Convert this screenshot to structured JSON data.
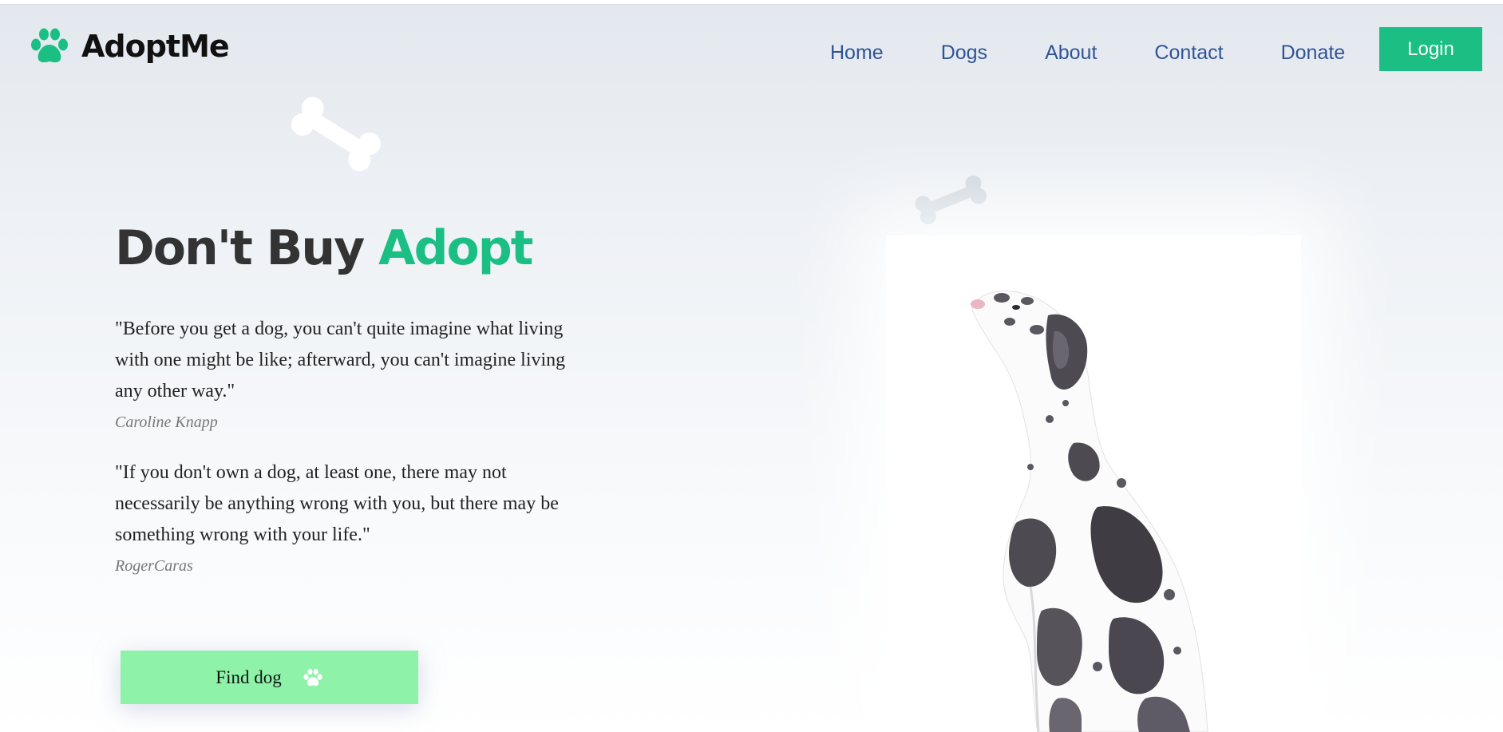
{
  "header": {
    "brand_name": "AdoptMe",
    "brand_icon": "paw-icon",
    "nav": [
      {
        "label": "Home"
      },
      {
        "label": "Dogs"
      },
      {
        "label": "About"
      },
      {
        "label": "Contact"
      },
      {
        "label": "Donate"
      }
    ],
    "login_label": "Login"
  },
  "hero": {
    "headline_prefix": "Don't Buy",
    "headline_accent": "Adopt",
    "quotes": [
      {
        "text": "\"Before you get a dog, you can't quite imagine what living with one might be like; afterward, you can't imagine living any other way.\"",
        "author": "Caroline Knapp"
      },
      {
        "text": "\"If you don't own a dog, at least one, there may not necessarily be anything wrong with you, but there may be something wrong with your life.\"",
        "author": "RogerCaras"
      }
    ],
    "cta_label": "Find dog",
    "cta_icon": "paw-icon"
  },
  "decor": {
    "bone_icons": [
      "bone-icon",
      "bone-icon"
    ],
    "image": "dalmatian-great-dane-dog"
  },
  "colors": {
    "accent": "#1bbf83",
    "nav_text": "#2f5496",
    "cta_background": "#8ef2a8",
    "headline": "#333333"
  }
}
